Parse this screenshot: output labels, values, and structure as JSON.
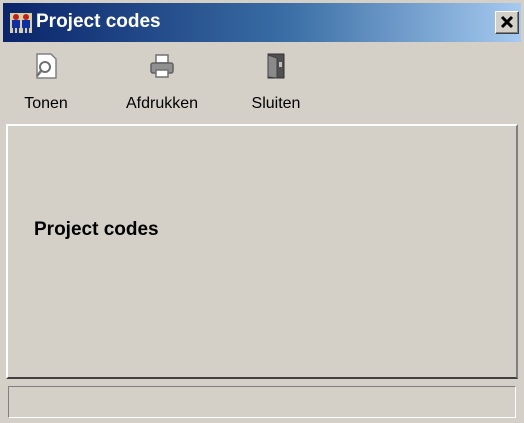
{
  "window": {
    "title": "Project codes",
    "title_icon": "people-icon",
    "close_icon": "close-icon",
    "colors": {
      "titlebar_start": "#0a246a",
      "titlebar_end": "#a6caf0",
      "face": "#d4d0c8"
    }
  },
  "toolbar": {
    "items": [
      {
        "label": "Tonen",
        "icon": "preview-icon"
      },
      {
        "label": "Afdrukken",
        "icon": "printer-icon"
      },
      {
        "label": "Sluiten",
        "icon": "door-exit-icon"
      }
    ]
  },
  "main": {
    "heading": "Project codes"
  },
  "statusbar": {
    "text": ""
  }
}
